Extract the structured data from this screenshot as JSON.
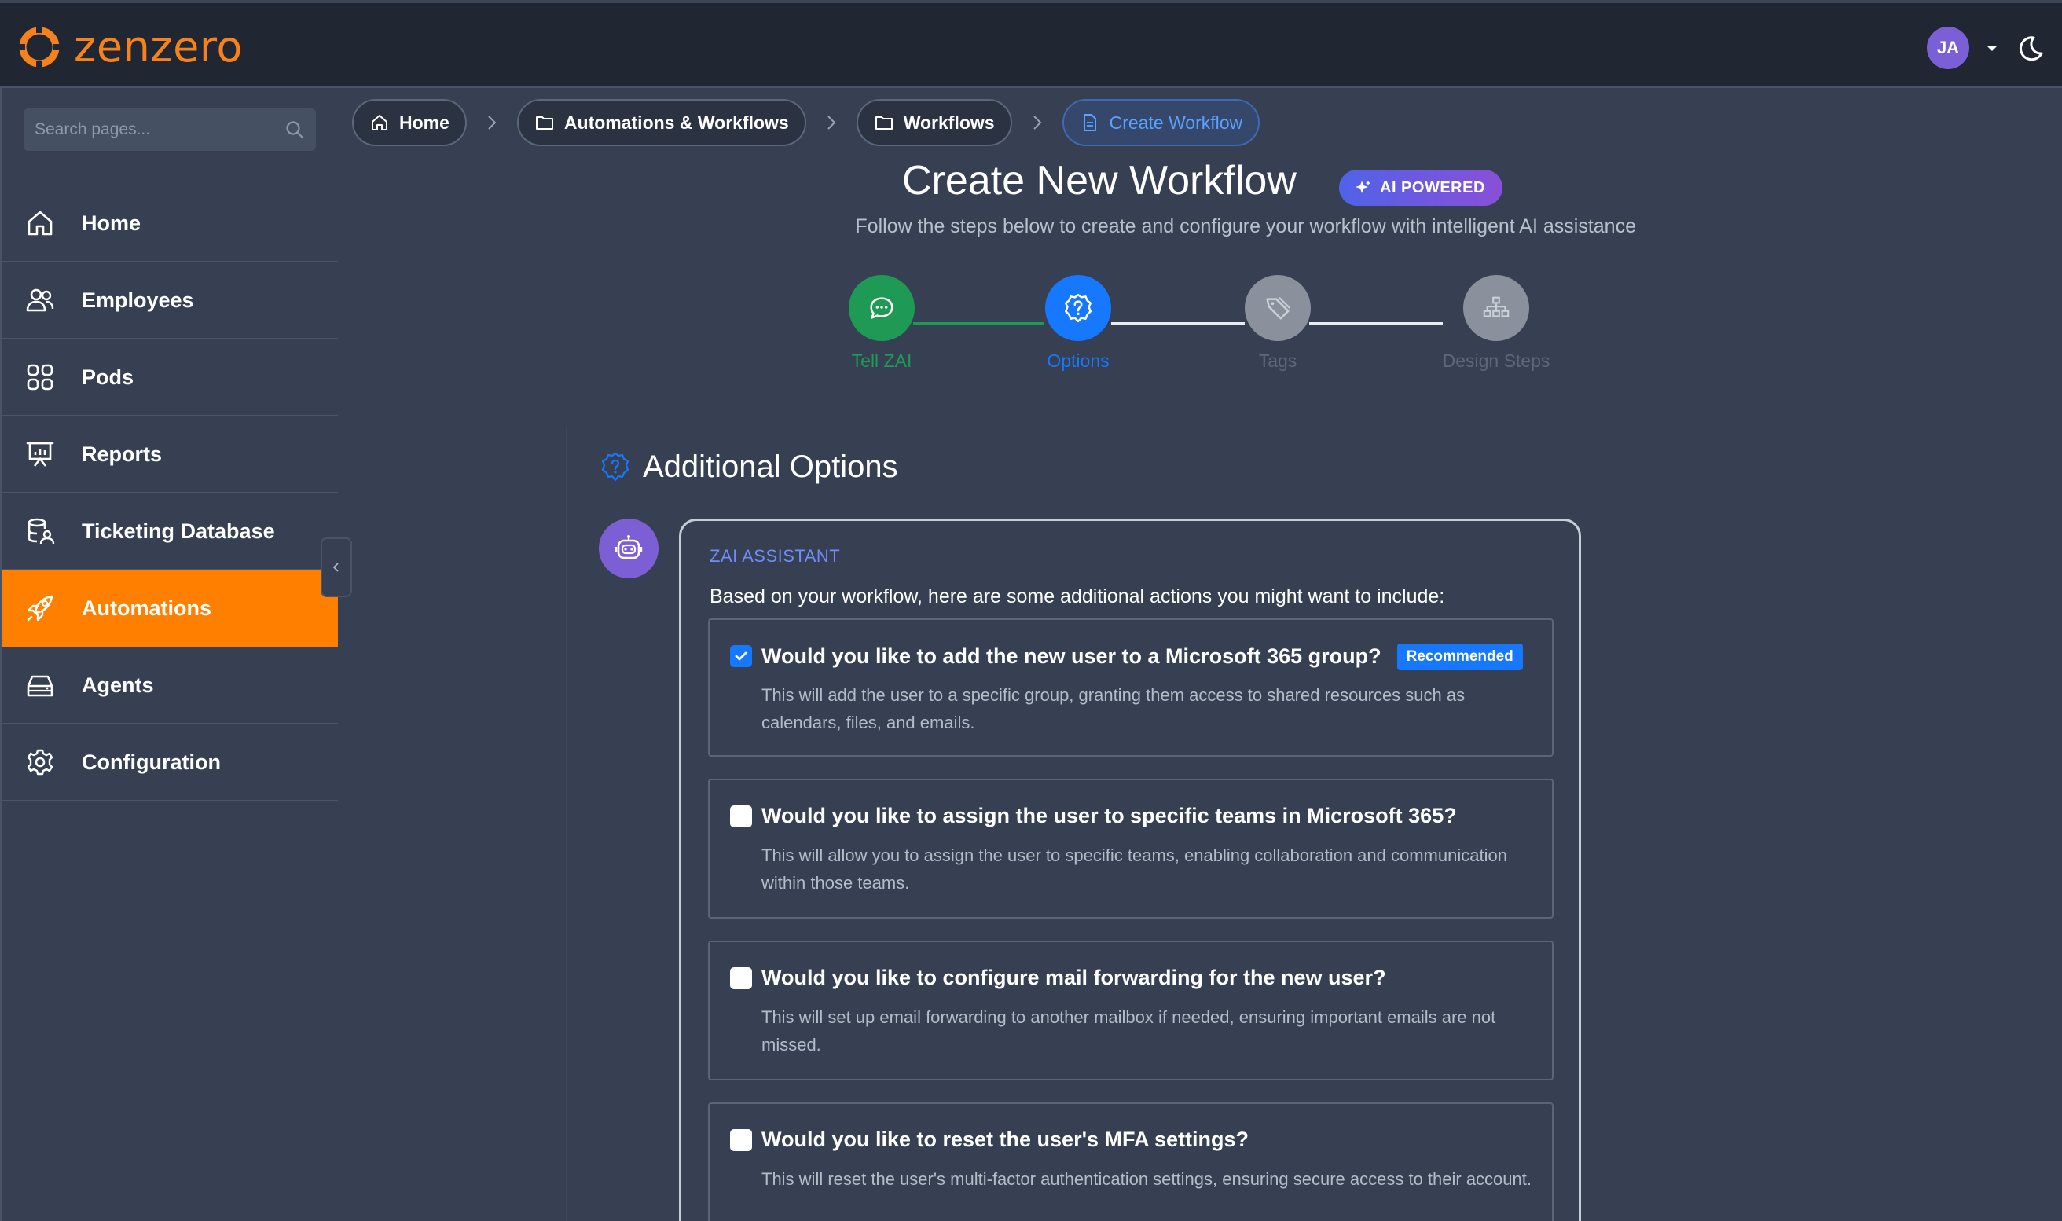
{
  "app": {
    "brand": "zenzero",
    "brand_color": "#f7821b",
    "user_initials": "JA",
    "theme_icon": "moon-icon"
  },
  "sidebar": {
    "search_placeholder": "Search pages...",
    "items": [
      {
        "label": "Home",
        "icon": "home-icon",
        "active": false
      },
      {
        "label": "Employees",
        "icon": "users-icon",
        "active": false
      },
      {
        "label": "Pods",
        "icon": "grid-icon",
        "active": false
      },
      {
        "label": "Reports",
        "icon": "presentation-icon",
        "active": false
      },
      {
        "label": "Ticketing Database",
        "icon": "database-user-icon",
        "active": false
      },
      {
        "label": "Automations",
        "icon": "rocket-icon",
        "active": true
      },
      {
        "label": "Agents",
        "icon": "server-icon",
        "active": false
      },
      {
        "label": "Configuration",
        "icon": "gear-icon",
        "active": false
      }
    ]
  },
  "breadcrumb": {
    "items": [
      {
        "label": "Home",
        "icon": "home-icon"
      },
      {
        "label": "Automations & Workflows",
        "icon": "folder-icon"
      },
      {
        "label": "Workflows",
        "icon": "folder-icon"
      },
      {
        "label": "Create Workflow",
        "icon": "document-icon",
        "current": true
      }
    ]
  },
  "header": {
    "title": "Create New Workflow",
    "badge": "AI POWERED",
    "subtitle": "Follow the steps below to create and configure your workflow with intelligent AI assistance"
  },
  "stepper": {
    "steps": [
      {
        "label": "Tell ZAI",
        "state": "complete",
        "icon": "chat-icon",
        "color": "#1e9a54"
      },
      {
        "label": "Options",
        "state": "current",
        "icon": "question-icon",
        "color": "#1677ff"
      },
      {
        "label": "Tags",
        "state": "upcoming",
        "icon": "tag-icon",
        "color": "#8b919c"
      },
      {
        "label": "Design Steps",
        "state": "upcoming",
        "icon": "sitemap-icon",
        "color": "#8b919c"
      }
    ]
  },
  "options_section": {
    "title": "Additional Options",
    "assistant_label": "ZAI ASSISTANT",
    "intro": "Based on your workflow, here are some additional actions you might want to include:",
    "options": [
      {
        "title": "Would you like to add the new user to a Microsoft 365 group?",
        "badge": "Recommended",
        "checked": true,
        "description": "This will add the user to a specific group, granting them access to shared resources such as calendars, files, and emails."
      },
      {
        "title": "Would you like to assign the user to specific teams in Microsoft 365?",
        "checked": false,
        "description": "This will allow you to assign the user to specific teams, enabling collaboration and communication within those teams."
      },
      {
        "title": "Would you like to configure mail forwarding for the new user?",
        "checked": false,
        "description": "This will set up email forwarding to another mailbox if needed, ensuring important emails are not missed."
      },
      {
        "title": "Would you like to reset the user's MFA settings?",
        "checked": false,
        "description": "This will reset the user's multi-factor authentication settings, ensuring secure access to their account."
      }
    ]
  }
}
